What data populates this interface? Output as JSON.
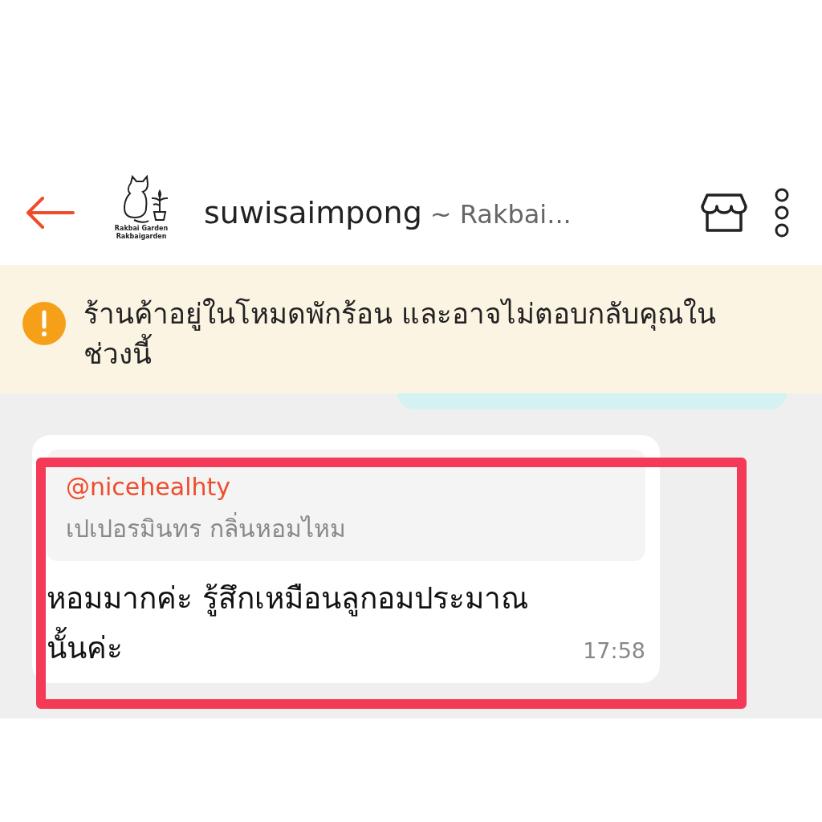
{
  "header": {
    "title": "suwisaimpong",
    "subtitle": "~ Rakbai...",
    "logo_lines": [
      "Rakbai Garden",
      "Rakbaigarden"
    ]
  },
  "notice": {
    "text": "ร้านค้าอยู่ในโหมดพักร้อน และอาจไม่ตอบกลับคุณในช่วงนี้"
  },
  "message": {
    "quote_author": "@nicehealhty",
    "quote_text": "เปเปอรมินทร กลิ่นหอมไหม",
    "text": "หอมมากค่ะ รู้สึกเหมือนลูกอมประมาณนั้นค่ะ",
    "time": "17:58",
    "highlighted": true
  }
}
